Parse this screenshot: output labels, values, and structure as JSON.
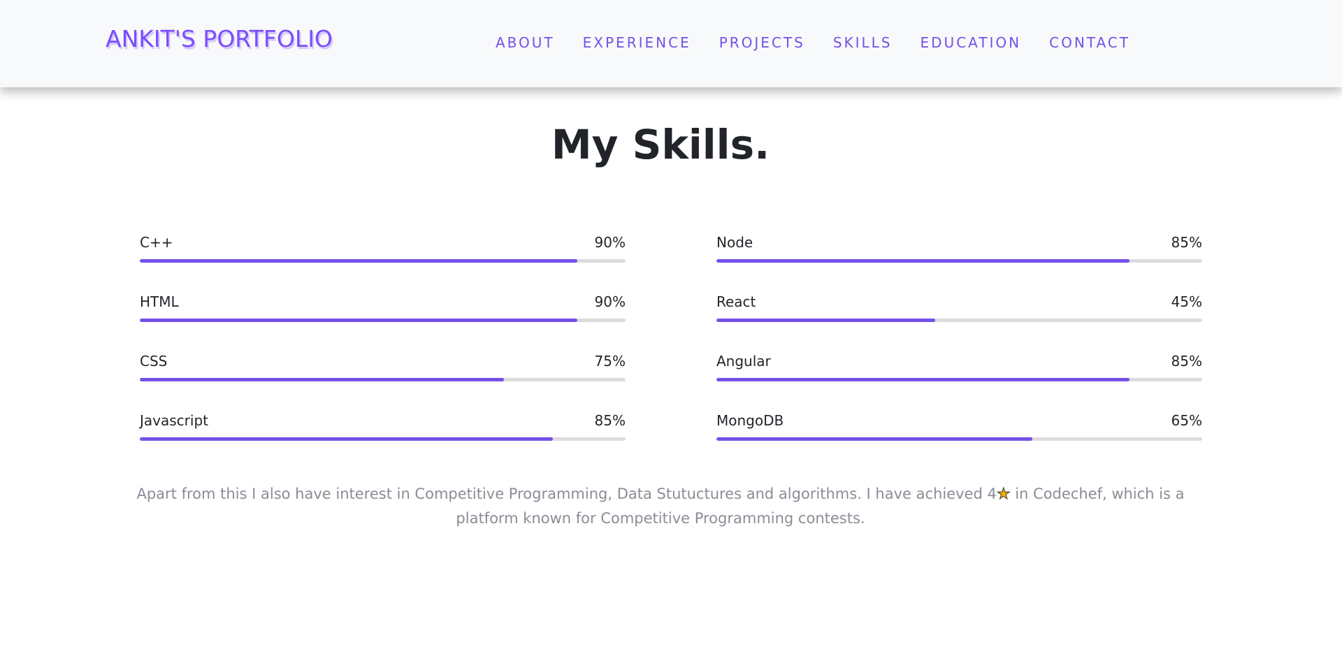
{
  "header": {
    "brand": "ANKIT'S PORTFOLIO",
    "nav": [
      "ABOUT",
      "EXPERIENCE",
      "PROJECTS",
      "SKILLS",
      "EDUCATION",
      "CONTACT"
    ]
  },
  "page_title": "My Skills.",
  "skills_left": [
    {
      "name": "C++",
      "pct_label": "90%",
      "level": 0.9
    },
    {
      "name": "HTML",
      "pct_label": "90%",
      "level": 0.9
    },
    {
      "name": "CSS",
      "pct_label": "75%",
      "level": 0.75
    },
    {
      "name": "Javascript",
      "pct_label": "85%",
      "level": 0.85
    }
  ],
  "skills_right": [
    {
      "name": "Node",
      "pct_label": "85%",
      "level": 0.85
    },
    {
      "name": "React",
      "pct_label": "45%",
      "level": 0.45
    },
    {
      "name": "Angular",
      "pct_label": "85%",
      "level": 0.85
    },
    {
      "name": "MongoDB",
      "pct_label": "65%",
      "level": 0.65
    }
  ],
  "footer": {
    "text_before_star": "Apart from this I also have interest in Competitive Programming, Data Stutuctures and algorithms. I have achieved 4",
    "star_icon": "star-icon",
    "text_after_star": " in Codechef, which is a platform known for Competitive Programming contests."
  },
  "colors": {
    "accent": "#7450e8",
    "brand": "#7a4dff",
    "track": "#dcdcdc",
    "muted_text": "#8a8d96"
  }
}
